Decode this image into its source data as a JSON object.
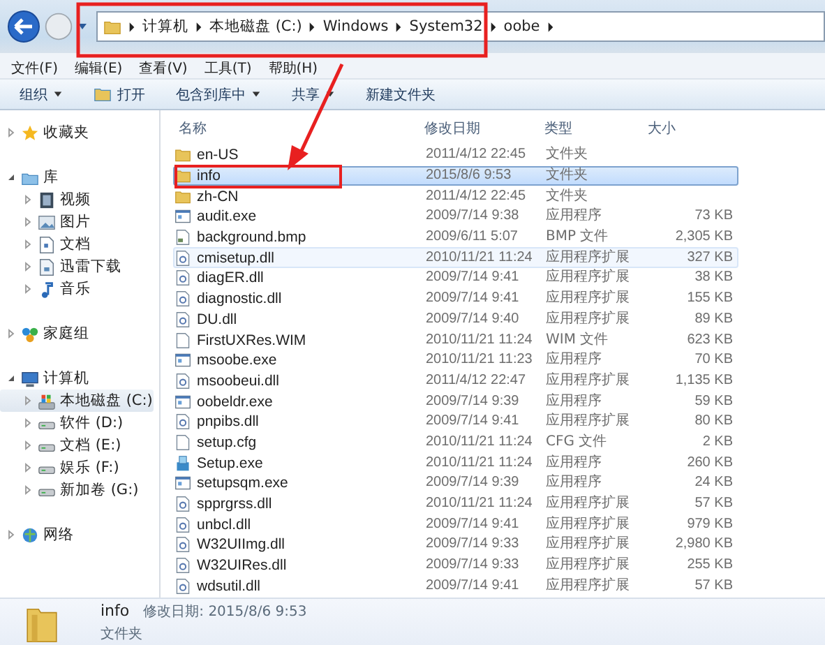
{
  "address": {
    "crumbs": [
      "计算机",
      "本地磁盘 (C:)",
      "Windows",
      "System32",
      "oobe"
    ]
  },
  "menu": [
    "文件(F)",
    "编辑(E)",
    "查看(V)",
    "工具(T)",
    "帮助(H)"
  ],
  "toolbar": [
    {
      "label": "组织",
      "kind": "dropdown"
    },
    {
      "label": "打开",
      "kind": "open"
    },
    {
      "label": "包含到库中",
      "kind": "dropdown"
    },
    {
      "label": "共享",
      "kind": "dropdown"
    },
    {
      "label": "新建文件夹",
      "kind": "plain"
    }
  ],
  "sidebar": {
    "items": [
      {
        "label": "收藏夹",
        "kind": "star",
        "expanded": false,
        "selected": false
      },
      {
        "label": "库",
        "kind": "library",
        "expanded": true,
        "selected": false,
        "children": [
          {
            "label": "视频",
            "kind": "video",
            "expanded": false,
            "selected": false
          },
          {
            "label": "图片",
            "kind": "image",
            "expanded": false,
            "selected": false
          },
          {
            "label": "文档",
            "kind": "doc",
            "expanded": false,
            "selected": false
          },
          {
            "label": "迅雷下载",
            "kind": "download",
            "expanded": false,
            "selected": false
          },
          {
            "label": "音乐",
            "kind": "music",
            "expanded": false,
            "selected": false
          }
        ]
      },
      {
        "label": "家庭组",
        "kind": "homegroup",
        "expanded": false,
        "selected": false
      },
      {
        "label": "计算机",
        "kind": "computer",
        "expanded": true,
        "selected": false,
        "children": [
          {
            "label": "本地磁盘 (C:)",
            "kind": "sysdrive",
            "expanded": false,
            "selected": true
          },
          {
            "label": "软件 (D:)",
            "kind": "drive",
            "expanded": false,
            "selected": false
          },
          {
            "label": "文档 (E:)",
            "kind": "drive",
            "expanded": false,
            "selected": false
          },
          {
            "label": "娱乐 (F:)",
            "kind": "drive",
            "expanded": false,
            "selected": false
          },
          {
            "label": "新加卷 (G:)",
            "kind": "drive",
            "expanded": false,
            "selected": false
          }
        ]
      },
      {
        "label": "网络",
        "kind": "network",
        "expanded": false,
        "selected": false
      }
    ]
  },
  "table": {
    "columns": [
      "名称",
      "修改日期",
      "类型",
      "大小"
    ],
    "rows": [
      {
        "name": "en-US",
        "date": "2011/4/12 22:45",
        "type": "文件夹",
        "kind": "folder",
        "selected": false,
        "hover": false
      },
      {
        "name": "info",
        "date": "2015/8/6 9:53",
        "type": "文件夹",
        "kind": "folder",
        "selected": true,
        "hover": false
      },
      {
        "name": "zh-CN",
        "date": "2011/4/12 22:45",
        "type": "文件夹",
        "kind": "folder",
        "selected": false,
        "hover": false
      },
      {
        "name": "audit.exe",
        "date": "2009/7/14 9:38",
        "type": "应用程序",
        "size": "73 KB",
        "kind": "exe",
        "selected": false,
        "hover": false
      },
      {
        "name": "background.bmp",
        "date": "2009/6/11 5:07",
        "type": "BMP 文件",
        "size": "2,305 KB",
        "kind": "bmp",
        "selected": false,
        "hover": false
      },
      {
        "name": "cmisetup.dll",
        "date": "2010/11/21 11:24",
        "type": "应用程序扩展",
        "size": "327 KB",
        "kind": "dll",
        "selected": false,
        "hover": true
      },
      {
        "name": "diagER.dll",
        "date": "2009/7/14 9:41",
        "type": "应用程序扩展",
        "size": "38 KB",
        "kind": "dll",
        "selected": false,
        "hover": false
      },
      {
        "name": "diagnostic.dll",
        "date": "2009/7/14 9:41",
        "type": "应用程序扩展",
        "size": "155 KB",
        "kind": "dll",
        "selected": false,
        "hover": false
      },
      {
        "name": "DU.dll",
        "date": "2009/7/14 9:40",
        "type": "应用程序扩展",
        "size": "89 KB",
        "kind": "dll",
        "selected": false,
        "hover": false
      },
      {
        "name": "FirstUXRes.WIM",
        "date": "2010/11/21 11:24",
        "type": "WIM 文件",
        "size": "623 KB",
        "kind": "file",
        "selected": false,
        "hover": false
      },
      {
        "name": "msoobe.exe",
        "date": "2010/11/21 11:23",
        "type": "应用程序",
        "size": "70 KB",
        "kind": "exe",
        "selected": false,
        "hover": false
      },
      {
        "name": "msoobeui.dll",
        "date": "2011/4/12 22:47",
        "type": "应用程序扩展",
        "size": "1,135 KB",
        "kind": "dll",
        "selected": false,
        "hover": false
      },
      {
        "name": "oobeldr.exe",
        "date": "2009/7/14 9:39",
        "type": "应用程序",
        "size": "59 KB",
        "kind": "exe",
        "selected": false,
        "hover": false
      },
      {
        "name": "pnpibs.dll",
        "date": "2009/7/14 9:41",
        "type": "应用程序扩展",
        "size": "80 KB",
        "kind": "dll",
        "selected": false,
        "hover": false
      },
      {
        "name": "setup.cfg",
        "date": "2010/11/21 11:24",
        "type": "CFG 文件",
        "size": "2 KB",
        "kind": "file",
        "selected": false,
        "hover": false
      },
      {
        "name": "Setup.exe",
        "date": "2010/11/21 11:24",
        "type": "应用程序",
        "size": "260 KB",
        "kind": "setup",
        "selected": false,
        "hover": false
      },
      {
        "name": "setupsqm.exe",
        "date": "2009/7/14 9:39",
        "type": "应用程序",
        "size": "24 KB",
        "kind": "exe",
        "selected": false,
        "hover": false
      },
      {
        "name": "spprgrss.dll",
        "date": "2010/11/21 11:24",
        "type": "应用程序扩展",
        "size": "57 KB",
        "kind": "dll",
        "selected": false,
        "hover": false
      },
      {
        "name": "unbcl.dll",
        "date": "2009/7/14 9:41",
        "type": "应用程序扩展",
        "size": "979 KB",
        "kind": "dll",
        "selected": false,
        "hover": false
      },
      {
        "name": "W32UIImg.dll",
        "date": "2009/7/14 9:33",
        "type": "应用程序扩展",
        "size": "2,980 KB",
        "kind": "dll",
        "selected": false,
        "hover": false
      },
      {
        "name": "W32UIRes.dll",
        "date": "2009/7/14 9:33",
        "type": "应用程序扩展",
        "size": "255 KB",
        "kind": "dll",
        "selected": false,
        "hover": false
      },
      {
        "name": "wdsutil.dll",
        "date": "2009/7/14 9:41",
        "type": "应用程序扩展",
        "size": "57 KB",
        "kind": "dll",
        "selected": false,
        "hover": false
      }
    ]
  },
  "details": {
    "name": "info",
    "modified": "修改日期: 2015/8/6 9:53",
    "type": "文件夹"
  }
}
